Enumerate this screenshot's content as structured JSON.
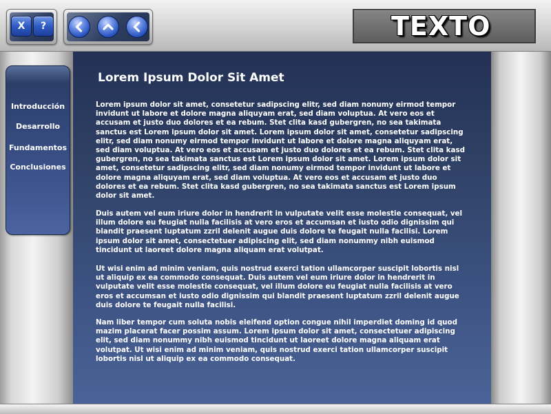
{
  "header": {
    "title": "TEXTO",
    "buttons": {
      "close_label": "X",
      "help_label": "?"
    }
  },
  "nav": {
    "items": [
      {
        "label": "Introducción"
      },
      {
        "label": "Desarrollo"
      },
      {
        "label": "Fundamentos"
      },
      {
        "label": "Conclusiones"
      }
    ]
  },
  "content": {
    "heading": "Lorem Ipsum Dolor Sit Amet",
    "paragraphs": [
      "Lorem ipsum dolor sit amet, consetetur sadipscing elitr, sed diam nonumy eirmod tempor invidunt ut labore et dolore magna aliquyam erat, sed diam voluptua. At vero eos et accusam et justo duo dolores et ea rebum. Stet clita kasd gubergren, no sea takimata sanctus est Lorem ipsum dolor sit amet. Lorem ipsum dolor sit amet, consetetur sadipscing elitr, sed diam nonumy eirmod tempor invidunt ut labore et dolore magna aliquyam erat, sed diam voluptua. At vero eos et accusam et justo duo dolores et ea rebum. Stet clita kasd gubergren, no sea takimata sanctus est Lorem ipsum dolor sit amet. Lorem ipsum dolor sit amet, consetetur sadipscing elitr, sed diam nonumy eirmod tempor invidunt ut labore et dolore magna aliquyam erat, sed diam voluptua. At vero eos et accusam et justo duo dolores et ea rebum. Stet clita kasd gubergren, no sea takimata sanctus est Lorem ipsum dolor sit amet.",
      "Duis autem vel eum iriure dolor in hendrerit in vulputate velit esse molestie consequat, vel illum dolore eu feugiat nulla facilisis at vero eros et accumsan et iusto odio dignissim qui blandit praesent luptatum zzril delenit augue duis dolore te feugait nulla facilisi. Lorem ipsum dolor sit amet, consectetuer adipiscing elit, sed diam nonummy nibh euismod tincidunt ut laoreet dolore magna aliquam erat volutpat.",
      "Ut wisi enim ad minim veniam, quis nostrud exerci tation ullamcorper suscipit lobortis nisl ut aliquip ex ea commodo consequat. Duis autem vel eum iriure dolor in hendrerit in vulputate velit esse molestie consequat, vel illum dolore eu feugiat nulla facilisis at vero eros et accumsan et iusto odio dignissim qui blandit praesent luptatum zzril delenit augue duis dolore te feugait nulla facilisi.",
      "Nam liber tempor cum soluta nobis eleifend option congue nihil imperdiet doming id quod mazim placerat facer possim assum. Lorem ipsum dolor sit amet, consectetuer adipiscing elit, sed diam nonummy nibh euismod tincidunt ut laoreet dolore magna aliquam erat volutpat. Ut wisi enim ad minim veniam, quis nostrud exerci tation ullamcorper suscipit lobortis nisl ut aliquip ex ea commodo consequat."
    ]
  },
  "icons": {
    "close": "close-icon",
    "help": "help-icon",
    "back": "chevron-left-icon",
    "up": "chevron-up-icon",
    "previous": "chevron-left-icon"
  },
  "colors": {
    "content_bg": "#2e4064",
    "nav_bg": "#34497c",
    "button_blue": "#2f5bc4",
    "text": "#ffffff"
  }
}
